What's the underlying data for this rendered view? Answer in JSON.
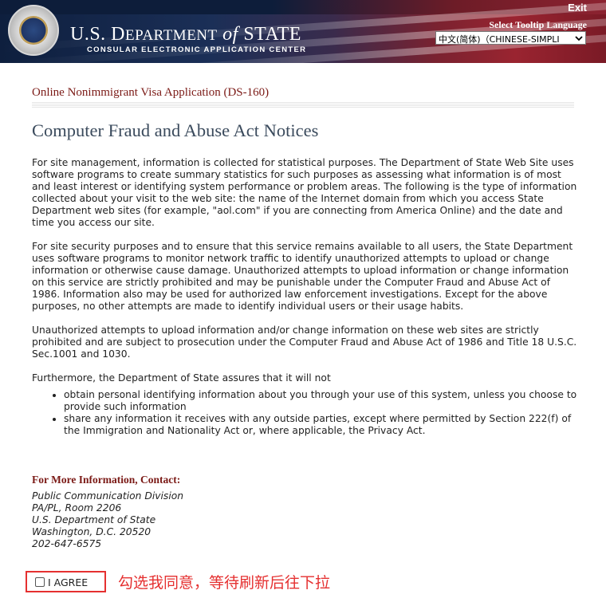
{
  "header": {
    "title_prefix": "U.S. D",
    "title_dept": "EPARTMENT",
    "title_of": "of",
    "title_state": "STATE",
    "subtitle": "CONSULAR ELECTRONIC APPLICATION CENTER",
    "exit_label": "Exit",
    "tooltip_language_label": "Select Tooltip Language",
    "language_selected": "中文(简体)（CHINESE-SIMPLI",
    "colors": {
      "banner_blue": "#1b2f57",
      "banner_red": "#9a2430"
    }
  },
  "page": {
    "app_title": "Online Nonimmigrant Visa Application (DS-160)",
    "title": "Computer Fraud and Abuse Act Notices",
    "paragraphs": [
      "For site management, information is collected for statistical purposes. The Department of State Web Site uses software programs to create summary statistics for such purposes as assessing what information is of most and least interest or identifying system performance or problem areas. The following is the type of information collected about your visit to the web site: the name of the Internet domain from which you access State Department web sites (for example, \"aol.com\" if you are connecting from America Online) and the date and time you access our site.",
      "For site security purposes and to ensure that this service remains available to all users, the State Department uses software programs to monitor network traffic to identify unauthorized attempts to upload or change information or otherwise cause damage. Unauthorized attempts to upload information or change information on this service are strictly prohibited and may be punishable under the Computer Fraud and Abuse Act of 1986. Information also may be used for authorized law enforcement investigations. Except for the above purposes, no other attempts are made to identify individual users or their usage habits.",
      "Unauthorized attempts to upload information and/or change information on these web sites are strictly prohibited and are subject to prosecution under the Computer Fraud and Abuse Act of 1986 and Title 18 U.S.C. Sec.1001 and 1030.",
      "Furthermore, the Department of State assures that it will not"
    ],
    "bullets": [
      "obtain personal identifying information about you through your use of this system, unless you choose to provide such information",
      "share any information it receives with any outside parties, except where permitted by Section 222(f) of the Immigration and Nationality Act or, where applicable, the Privacy Act."
    ],
    "contact_heading": "For More Information, Contact:",
    "contact_lines": [
      "Public Communication Division",
      "PA/PL, Room 2206",
      "U.S. Department of State",
      "Washington, D.C. 20520",
      "202-647-6575"
    ],
    "agree_label": "I AGREE",
    "agree_checked": false,
    "annotation": "勾选我同意，等待刷新后往下拉",
    "colors": {
      "heading_red": "#7b1a16",
      "annotation_red": "#e53030",
      "title_slate": "#3a4a5c"
    }
  }
}
